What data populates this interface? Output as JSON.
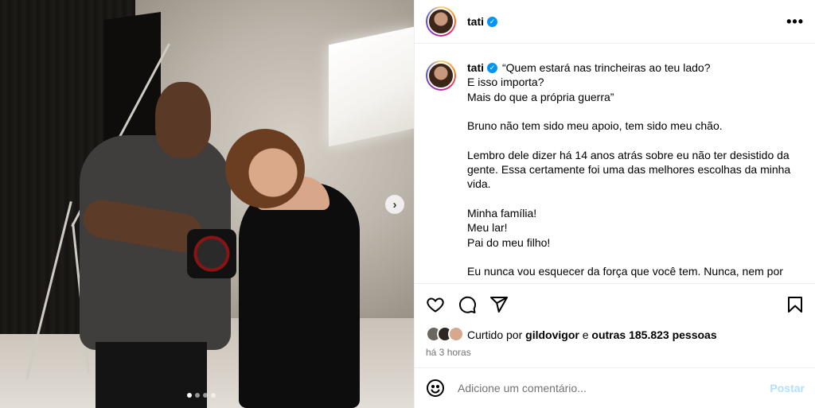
{
  "media": {
    "next_icon": "chevron-right-icon",
    "dots_total": 4,
    "dots_active": 1
  },
  "header": {
    "username": "tati",
    "verified_icon": "verified-badge-icon",
    "more_icon": "more-horizontal-icon",
    "more_label": "•••"
  },
  "caption": {
    "username": "tati",
    "lines": [
      "“Quem estará nas trincheiras ao teu lado?",
      "E isso importa?",
      "Mais do que a própria guerra”",
      "",
      "Bruno não tem sido meu apoio, tem sido meu chão.",
      "",
      "Lembro dele dizer há 14 anos atrás sobre eu não ter desistido da",
      "gente. Essa certamente foi uma das melhores escolhas da minha",
      "vida.",
      "",
      "Minha família!",
      "Meu lar!",
      "Pai do meu filho!",
      "",
      "Eu nunca vou esquecer da força que você tem. Nunca, nem por um"
    ]
  },
  "actions": {
    "like_icon": "heart-icon",
    "comment_icon": "comment-bubble-icon",
    "share_icon": "send-paper-plane-icon",
    "save_icon": "bookmark-icon"
  },
  "likes": {
    "prefix": "Curtido por",
    "user": "gildovigor",
    "conjunction": "e",
    "others": "outras 185.823 pessoas"
  },
  "timestamp": "há 3 horas",
  "comment": {
    "emoji_icon": "smiley-face-icon",
    "placeholder": "Adicione um comentário...",
    "post_label": "Postar"
  }
}
